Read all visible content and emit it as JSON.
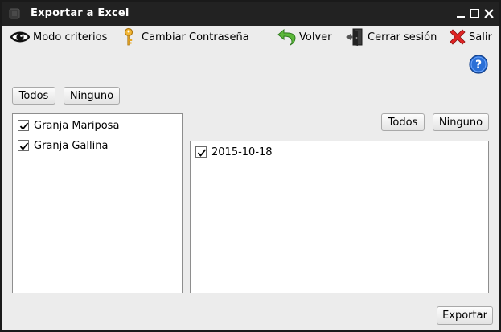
{
  "window": {
    "title": "Exportar a Excel"
  },
  "toolbar": {
    "modo_criterios": "Modo criterios",
    "cambiar_contrasena": "Cambiar Contraseña",
    "volver": "Volver",
    "cerrar_sesion": "Cerrar sesión",
    "salir": "Salir"
  },
  "left_panel": {
    "todos": "Todos",
    "ninguno": "Ninguno",
    "items": [
      {
        "label": "Granja Mariposa",
        "checked": true
      },
      {
        "label": "Granja Gallina",
        "checked": true
      }
    ]
  },
  "right_panel": {
    "todos": "Todos",
    "ninguno": "Ninguno",
    "items": [
      {
        "label": "2015-10-18",
        "checked": true
      }
    ]
  },
  "footer": {
    "exportar": "Exportar"
  },
  "icons": {
    "title": "app-icon",
    "modo_criterios": "eye-icon",
    "cambiar_contrasena": "key-icon",
    "volver": "back-arrow-icon",
    "cerrar_sesion": "logout-door-icon",
    "salir": "close-x-icon",
    "help": "help-icon"
  },
  "colors": {
    "titlebar": "#222222",
    "window_bg": "#ececec",
    "help_blue": "#2a6fd6",
    "salir_red": "#d62020",
    "volver_green": "#3a9a2a",
    "key_gold": "#e0a020"
  }
}
